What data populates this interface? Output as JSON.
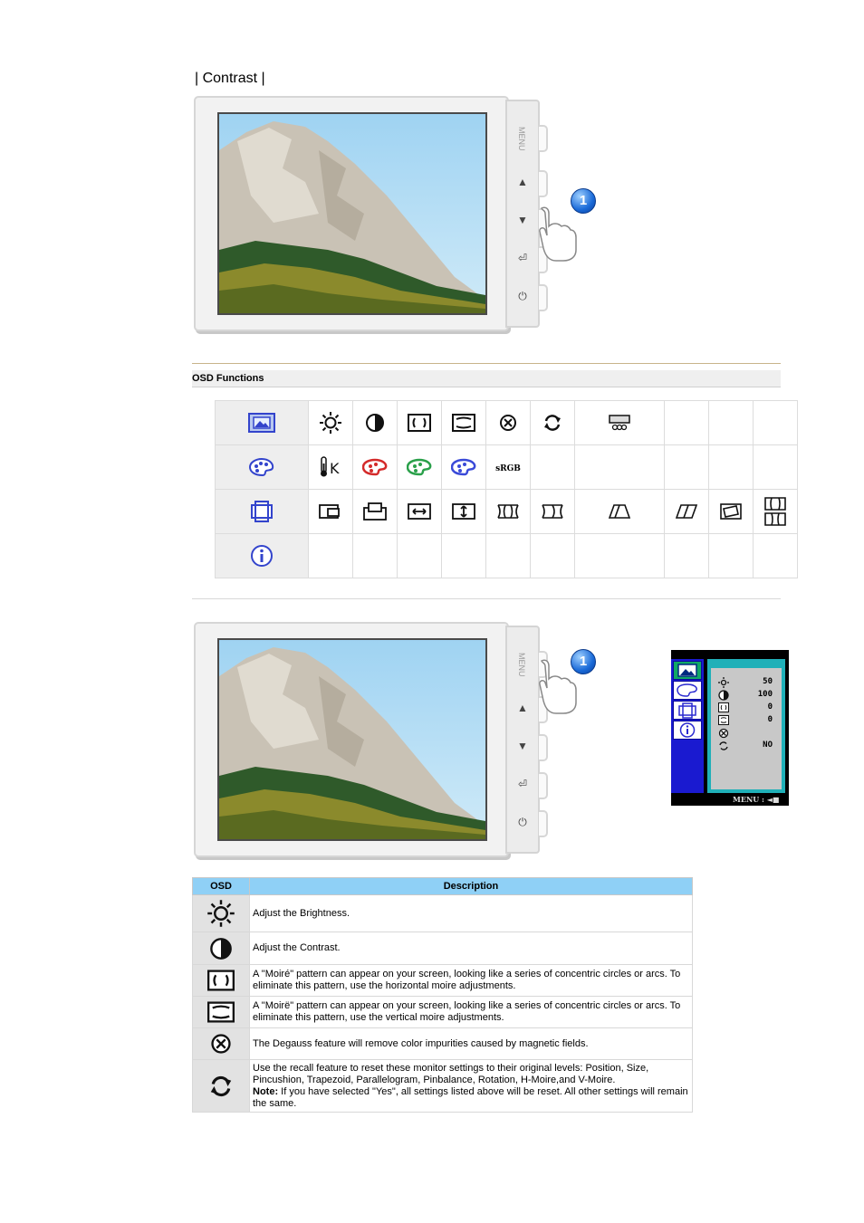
{
  "heading": "| Contrast |",
  "monitor": {
    "buttons": {
      "menu": "MENU",
      "up": "▲",
      "down": "▼",
      "enter": "⏎",
      "power": "⏻"
    },
    "step_number": "1"
  },
  "section_title": "OSD Functions",
  "osd_grid": {
    "rows": [
      {
        "category_icon": "picture-icon",
        "items": [
          "brightness-icon",
          "contrast-icon",
          "h-moire-icon",
          "v-moire-icon",
          "degauss-icon",
          "recall-icon",
          "osd-settings-icon"
        ]
      },
      {
        "category_icon": "color-palette-icon",
        "items": [
          "color-temperature-icon",
          "red-icon",
          "green-icon",
          "blue-icon",
          "srgb"
        ]
      },
      {
        "category_icon": "geometry-icon",
        "items": [
          "h-position-icon",
          "v-position-icon",
          "h-size-icon",
          "v-size-icon",
          "pincushion-icon",
          "pin-balance-icon",
          "trapezoid-icon",
          "parallelogram-icon",
          "rotation-icon",
          "top-bottom-corner-icon"
        ]
      },
      {
        "category_icon": "info-icon",
        "items": []
      }
    ],
    "srgb_label": "sRGB",
    "colors": {
      "red": "#d42a2a",
      "green": "#2aa04a",
      "blue": "#3a4ad8",
      "category": "#3344cc"
    }
  },
  "osd_menu": {
    "values": [
      "50",
      "100",
      "0",
      "0",
      "",
      "NO"
    ],
    "footer": "MENU : "
  },
  "description_table": {
    "headers": {
      "osd": "OSD",
      "description": "Description"
    },
    "rows": [
      {
        "icon": "brightness-icon",
        "text": "Adjust the Brightness."
      },
      {
        "icon": "contrast-icon",
        "text": "Adjust the Contrast."
      },
      {
        "icon": "h-moire-icon",
        "text": "A \"Moiré\" pattern can appear on your screen, looking like a series of concentric circles or arcs. To eliminate this pattern, use the horizontal moire adjustments."
      },
      {
        "icon": "v-moire-icon",
        "text": "A \"Moirë\" pattern can appear on your screen, looking like a series of concentric circles or arcs. To eliminate this pattern, use the vertical moire adjustments."
      },
      {
        "icon": "degauss-icon",
        "text": "The Degauss feature will remove color impurities caused by magnetic fields."
      },
      {
        "icon": "recall-icon",
        "text": "Use the recall feature to reset these monitor settings to their original levels: Position, Size, Pincushion, Trapezoid, Parallelogram, Pinbalance, Rotation, H-Moire,and V-Moire.",
        "note_label": "Note:",
        "note": " If you have selected \"Yes\", all settings listed above will be reset. All other settings will remain the same."
      }
    ]
  }
}
